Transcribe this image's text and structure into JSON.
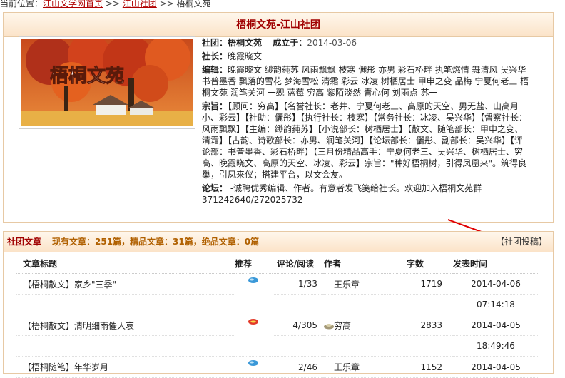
{
  "breadcrumb": {
    "prefix": "当前位置：",
    "home": "江山文学网首页",
    "sep1": " >> ",
    "club": "江山社团",
    "sep2": " >> ",
    "current": "梧桐文苑"
  },
  "club": {
    "title": "梧桐文苑-江山社团",
    "banner_text": "梧桐文苑",
    "name_label": "社团：",
    "name": "梧桐文苑",
    "founded_label": "成立于：",
    "founded": "2014-03-06",
    "president_label": "社长：",
    "president": "晚霞晓文",
    "editors_label": "编辑：",
    "editors": "晚霞晓文 缈韵莼苏 风雨飘飘 枝寒 儷彤 亦男 彩石桥畔 执笔燃情 舞清风 吴兴华 书普墨香 飘落的雪花 梦海雪松 清霜 彩云 冰凌 树栖居士 甲申之变 品梅 宁夏何老三 梧桐文苑 润笔关河 一觋 蓝莓 穷高 紫陌淡然 青心何 刘雨点 苏一",
    "purpose_label": "宗旨：",
    "purpose": "【顾问：穷高】【名誉社长：老井、宁夏何老三、高原的天空、男无盐、山高月小、彩云】【社助：儷彤】【执行社长：枝寒】【常务社长：冰凌、吴兴华】【督察社长：风雨飘飘】【主编：缈韵莼苏】【小说部长：树栖居士】【散文、随笔部长：甲申之变、清霜】【古韵、诗歌部长：亦男、润笔关河】【论坛部长：儷彤、副部长：吴兴华】【评论部：书普墨香、彩石桥畔】【三月份精品高手：宁夏何老三、吴兴华、树栖居士、穷高、晚霞晓文、高原的天空、冰凌、彩云】宗旨：\"种好梧桐树，引得凤凰来\"。筑得良巢，引凤来仪；搭建平台，以文会友。",
    "forum_label": "论坛：",
    "forum": " -诚聘优秀编辑、作者。有意者发飞笺给社长。欢迎加入梧桐文苑群371242640/272025732"
  },
  "articles": {
    "header_title": "社团文章",
    "stats": "现有文章：251篇，精品文章：31篇，绝品文章：0篇",
    "submit": "【社团投稿】",
    "columns": [
      "文章标题",
      "推荐",
      "评论/阅读",
      "作者",
      "字数",
      "发表时间"
    ],
    "rows": [
      {
        "title": "【梧桐散文】家乡\"三季\"",
        "rec": "blue",
        "stat": "1/33",
        "author": "王乐章",
        "words": "1719",
        "date": "2014-04-06",
        "time": "07:14:18"
      },
      {
        "title": "【梧桐散文】清明细雨催人哀",
        "rec": "red",
        "stat": "4/305",
        "author": "穷高",
        "words": "2833",
        "date": "2014-04-05",
        "time": "18:49:46"
      },
      {
        "title": "【梧桐随笔】年华岁月",
        "rec": "blue",
        "stat": "2/46",
        "author": "王乐章",
        "words": "1152",
        "date": "2014-04-05",
        "time": ""
      }
    ]
  },
  "colors": {
    "accent_red": "#a00000",
    "stats_orange": "#b06000",
    "border": "#e7c9a4"
  }
}
